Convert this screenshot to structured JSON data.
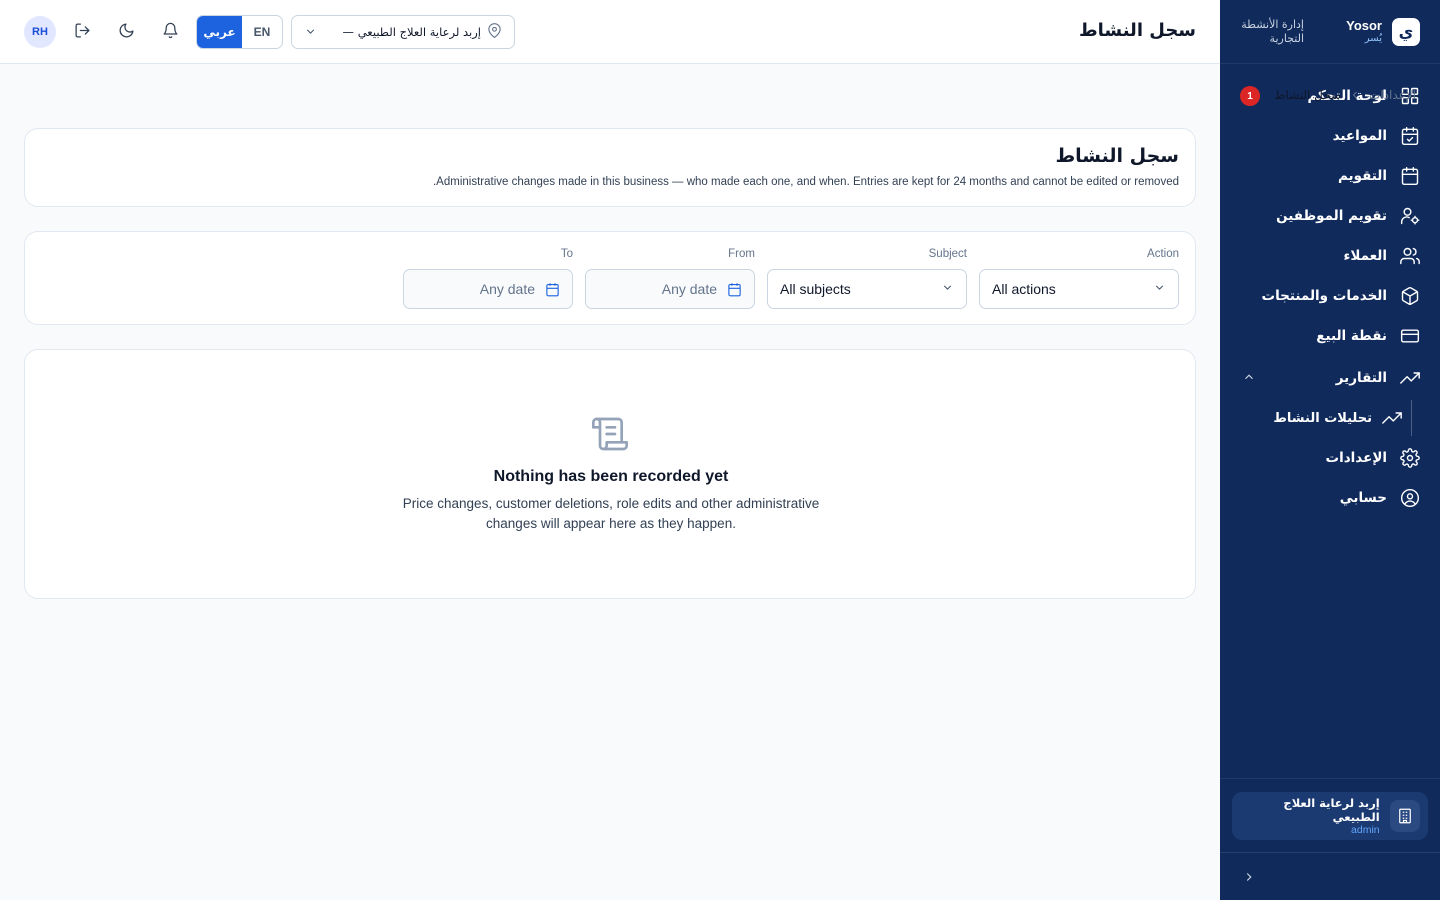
{
  "sidebar": {
    "brand_logo": "ي",
    "brand_name_en": "Yosor",
    "brand_name_ar": "يُسر",
    "brand_desc": "إدارة الأنشطة التجارية",
    "nav": [
      {
        "label": "لوحة التحكم",
        "icon": "dashboard-icon",
        "badge": "1"
      },
      {
        "label": "المواعيد",
        "icon": "calendar-check-icon"
      },
      {
        "label": "التقويم",
        "icon": "calendar-icon"
      },
      {
        "label": "تقويم الموظفين",
        "icon": "user-cog-icon"
      },
      {
        "label": "العملاء",
        "icon": "users-icon"
      },
      {
        "label": "الخدمات والمنتجات",
        "icon": "package-icon"
      },
      {
        "label": "نقطة البيع",
        "icon": "credit-card-icon"
      },
      {
        "label": "التقارير",
        "icon": "trending-up-icon",
        "expanded": true
      },
      {
        "label": "تحليلات النشاط",
        "icon": "trending-up-icon",
        "sub": true
      },
      {
        "label": "الإعدادات",
        "icon": "gear-icon"
      },
      {
        "label": "حسابي",
        "icon": "user-circle-icon"
      }
    ],
    "business_name": "إربد لرعاية العلاج الطبيعي",
    "business_role": "admin"
  },
  "header": {
    "title": "سجل النشاط",
    "avatar_initials": "RH",
    "lang_ar": "عربي",
    "lang_en": "EN",
    "branch": "إربد لرعاية العلاج الطبيعي — ..."
  },
  "breadcrumb": {
    "parent": "الإعدادات",
    "current": "سجل النشاط"
  },
  "title_card": {
    "title": "سجل النشاط",
    "description": "Administrative changes made in this business — who made each one, and when. Entries are kept for 24 months and cannot be edited or removed."
  },
  "filters": {
    "action_label": "Action",
    "action_value": "All actions",
    "subject_label": "Subject",
    "subject_value": "All subjects",
    "from_label": "From",
    "from_placeholder": "Any date",
    "to_label": "To",
    "to_placeholder": "Any date"
  },
  "empty_state": {
    "title": "Nothing has been recorded yet",
    "description": "Price changes, customer deletions, role edits and other administrative changes will appear here as they happen."
  },
  "colors": {
    "sidebar_bg": "#102a5c",
    "accent": "#1d63e0",
    "badge": "#dc2626"
  }
}
